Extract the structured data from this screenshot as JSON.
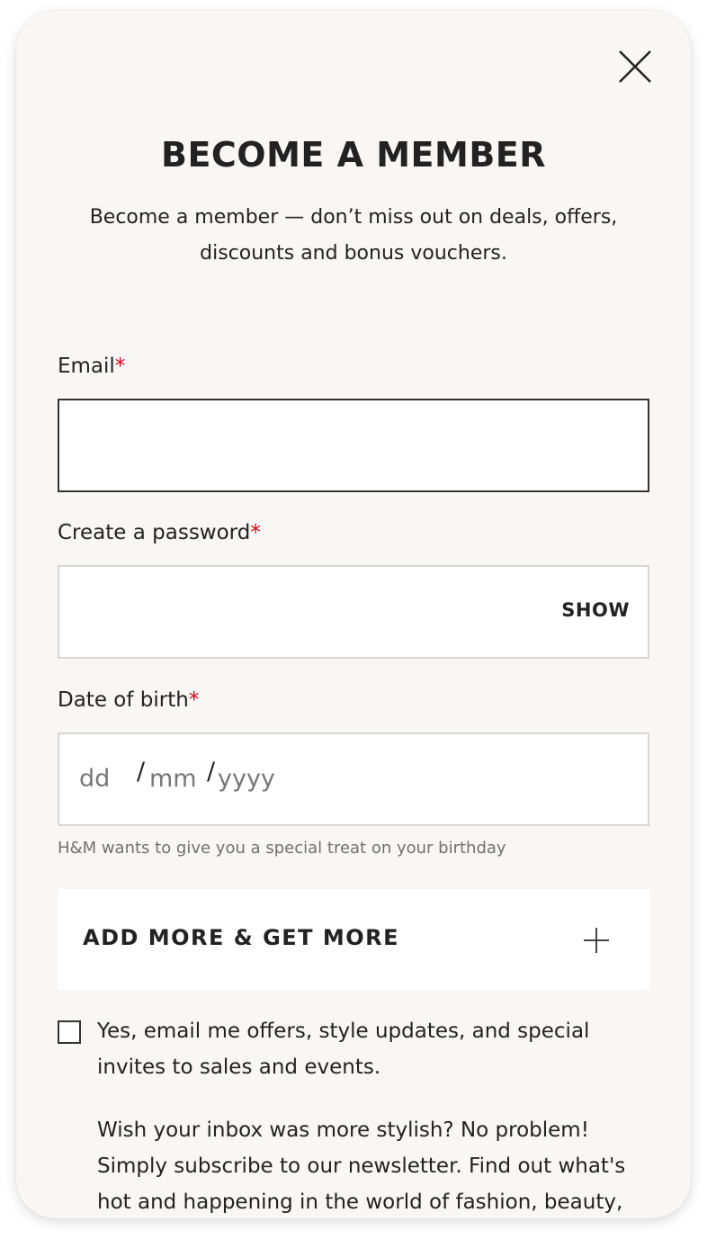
{
  "modal": {
    "title": "BECOME A MEMBER",
    "subtitle": "Become a member — don’t miss out on deals, offers, discounts and bonus vouchers.",
    "close_icon": "close-icon"
  },
  "form": {
    "email": {
      "label": "Email",
      "required_mark": "*",
      "value": ""
    },
    "password": {
      "label": "Create a password",
      "required_mark": "*",
      "value": "",
      "show_label": "SHOW"
    },
    "dob": {
      "label": "Date of birth",
      "required_mark": "*",
      "day_placeholder": "dd",
      "month_placeholder": "mm",
      "year_placeholder": "yyyy",
      "separator": "/",
      "hint": "H&M wants to give you a special treat on your birthday"
    },
    "add_more": {
      "label": "ADD MORE & GET MORE",
      "icon": "plus-icon"
    },
    "marketing_opt_in": {
      "checked": false,
      "label": "Yes, email me offers, style updates, and special invites to sales and events."
    },
    "newsletter_text": "Wish your inbox was more stylish? No problem! Simply subscribe to our newsletter. Find out what's hot and happening in the world of fashion, beauty,"
  },
  "colors": {
    "background": "#f8f7f5",
    "required": "#d0021b",
    "text": "#222222",
    "muted": "#707070"
  }
}
